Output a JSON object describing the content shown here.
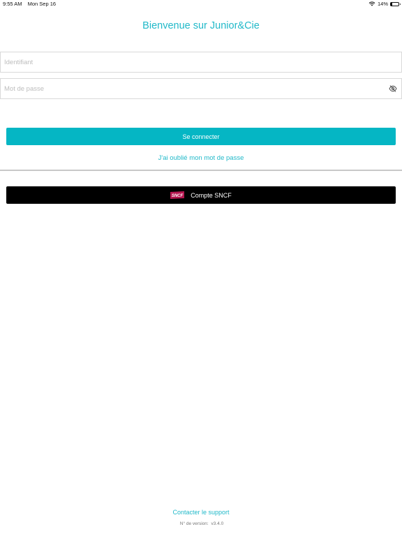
{
  "status_bar": {
    "time": "9:55 AM",
    "date": "Mon Sep 16",
    "battery_percent": "14%",
    "battery_level": 0.14,
    "icons": [
      "wifi-icon",
      "battery-icon"
    ]
  },
  "header": {
    "title": "Bienvenue sur Junior&Cie"
  },
  "form": {
    "login_placeholder": "Identifiant",
    "login_value": "",
    "password_placeholder": "Mot de passe",
    "password_value": "",
    "password_toggle_icon": "eye-slash-icon",
    "connect_label": "Se connecter",
    "forgot_label": "J'ai oublié mon mot de passe"
  },
  "sso": {
    "sncf_label": "Compte SNCF",
    "sncf_logo_text": "SNCF"
  },
  "footer": {
    "support_label": "Contacter le support",
    "version_label": "N° de version:",
    "version_value": "v3.4.0"
  },
  "colors": {
    "accent": "#21b9c9",
    "button_primary": "#05b6c4",
    "button_sncf": "#000000",
    "sncf_logo": "#b5164f"
  }
}
